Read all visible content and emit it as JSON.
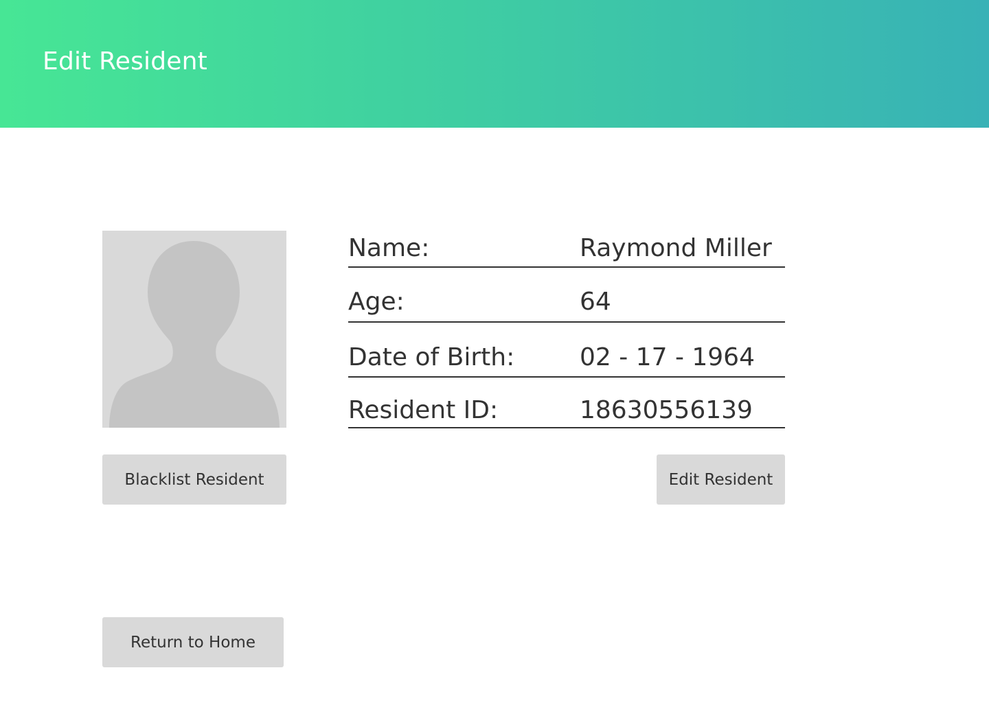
{
  "header": {
    "title": "Edit Resident",
    "gradient_start": "#47e695",
    "gradient_end": "#38b2b6"
  },
  "avatar": {
    "icon": "person-placeholder-icon",
    "background": "#d9d9d9",
    "silhouette_color": "#c4c4c4"
  },
  "fields": [
    {
      "label": "Name:",
      "value": "Raymond Miller"
    },
    {
      "label": "Age:",
      "value": "64"
    },
    {
      "label": "Date of Birth:",
      "value": "02 - 17 - 1964"
    },
    {
      "label": "Resident ID:",
      "value": "18630556139"
    }
  ],
  "buttons": {
    "blacklist": "Blacklist Resident",
    "edit": "Edit Resident",
    "return_home": "Return to Home"
  }
}
